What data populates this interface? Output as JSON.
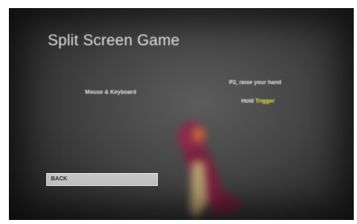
{
  "screen": {
    "title": "Split Screen Game",
    "left_input_label": "Mouse & Keyboard",
    "player_prompt": "P2, raise your hand",
    "hold_text": "Hold",
    "trigger_text": "Trigger",
    "back_button_label": "BACK"
  },
  "colors": {
    "background": "#3a3a3a",
    "text": "#f2f2f2",
    "trigger_highlight": "#e3e83a",
    "button": "#c9c9c9"
  }
}
